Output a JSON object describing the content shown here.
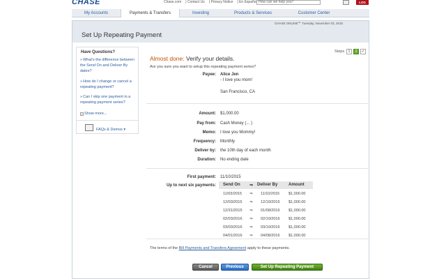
{
  "header": {
    "logo": "CHASE",
    "links": [
      "Chase.com",
      "Contact Us",
      "Privacy Notice",
      "En Español"
    ],
    "search_placeholder": "How can we help you?",
    "logoff_label": "LOG OFF"
  },
  "nav": {
    "tabs": [
      {
        "label": "My Accounts",
        "active": false
      },
      {
        "label": "Payments & Transfers",
        "active": true
      },
      {
        "label": "Investing",
        "active": false
      },
      {
        "label": "Products & Services",
        "active": false
      },
      {
        "label": "Customer Center",
        "active": false
      }
    ]
  },
  "page": {
    "title": "Set Up Repeating Payment",
    "meta": "CHASE ONLINE℠   Tuesday, November 03, 2015"
  },
  "sidebar": {
    "heading": "Have Questions?",
    "links": [
      "What's the difference between the Send On and Deliver By dates?",
      "How do I change or cancel a repeating payment?",
      "Can I skip one payment in a repeating payment series?"
    ],
    "show_more": "Show more...",
    "faqs": "FAQs & Demos ▾"
  },
  "main": {
    "almost": "Almost done:",
    "verify": "Verify your details.",
    "steps_label": "Steps",
    "steps": [
      "1",
      "2",
      "✓"
    ],
    "sure": "Are you sure you want to setup this repeating payment series?",
    "payee_label": "Payee:",
    "payee_name": "Alice Jen",
    "payee_note": "- I love you mom!",
    "payee_city": "San Francisco, CA",
    "amount_label": "Amount:",
    "amount": "$1,000.00",
    "payfrom_label": "Pay from:",
    "payfrom": "Cash Money (...          )",
    "memo_label": "Memo:",
    "memo": "I love you Mommy!",
    "frequency_label": "Frequency:",
    "frequency": "Monthly",
    "deliverby_label": "Deliver by:",
    "deliverby": "the 10th day of each month",
    "duration_label": "Duration:",
    "duration": "No ending date",
    "firstpay_label": "First payment:",
    "firstpay": "11/10/2015",
    "upto_label": "Up to next six payments:"
  },
  "schedule": {
    "headers": [
      "Send On",
      "Deliver By",
      "Amount"
    ],
    "rows": [
      [
        "11/03/2015",
        "11/10/2015",
        "$1,000.00"
      ],
      [
        "12/03/2015",
        "12/10/2015",
        "$1,000.00"
      ],
      [
        "12/31/2015",
        "01/08/2016",
        "$1,000.00"
      ],
      [
        "02/03/2016",
        "02/10/2016",
        "$1,000.00"
      ],
      [
        "03/03/2016",
        "03/10/2016",
        "$1,000.00"
      ],
      [
        "04/01/2016",
        "04/08/2016",
        "$1,000.00"
      ]
    ],
    "arrow": "⇒"
  },
  "terms": {
    "before": "The terms of the ",
    "link": "Bill Payments and Transfers Agreement",
    "after": " apply to these payments."
  },
  "buttons": {
    "cancel": "Cancel",
    "previous": "Previous",
    "submit": "Set Up Repeating Payment"
  },
  "colors": {
    "accent_orange": "#c45100",
    "link_blue": "#2a5d9b",
    "submit_green": "#4f8f1e",
    "logoff_red": "#b0111b"
  }
}
